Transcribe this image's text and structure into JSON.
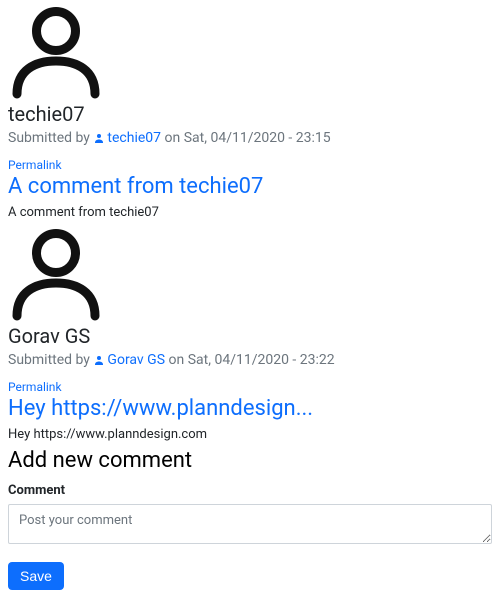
{
  "labels": {
    "submitted_by": "Submitted by",
    "on": "on",
    "permalink": "Permalink",
    "add_new_comment": "Add new comment",
    "comment_field": "Comment",
    "comment_placeholder": "Post your comment",
    "save": "Save"
  },
  "comments": [
    {
      "author": "techie07",
      "byline_author": "techie07",
      "date": "Sat, 04/11/2020 - 23:15",
      "title": "A comment from techie07",
      "body": "A comment from techie07"
    },
    {
      "author": "Gorav GS",
      "byline_author": "Gorav GS",
      "date": "Sat, 04/11/2020 - 23:22",
      "title": "Hey https://www.planndesign...",
      "body": "Hey https://www.planndesign.com"
    }
  ]
}
